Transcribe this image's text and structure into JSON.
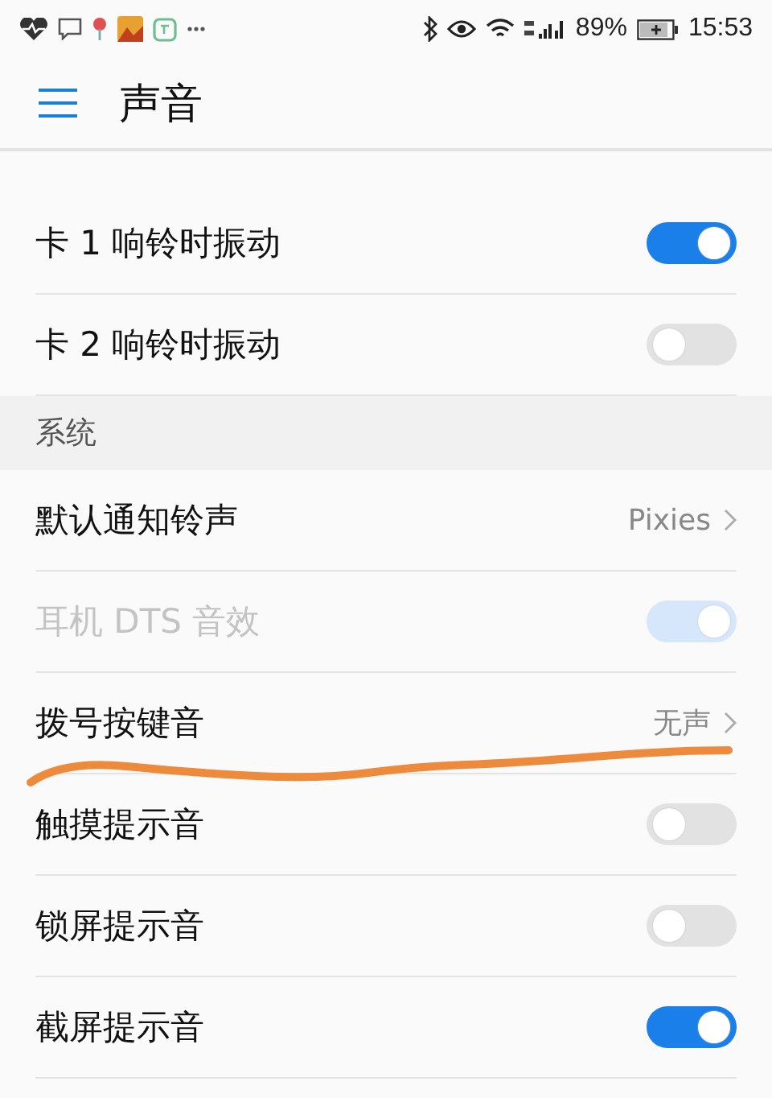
{
  "status_bar": {
    "battery": "89%",
    "time": "15:53"
  },
  "header": {
    "title": "声音"
  },
  "sections": [
    {
      "rows": [
        {
          "kind": "toggle",
          "label": "卡 1 响铃时振动",
          "on": true,
          "disabled": false
        },
        {
          "kind": "toggle",
          "label": "卡 2 响铃时振动",
          "on": false,
          "disabled": false
        }
      ]
    },
    {
      "title": "系统",
      "rows": [
        {
          "kind": "link",
          "label": "默认通知铃声",
          "value": "Pixies",
          "disabled": false
        },
        {
          "kind": "toggle",
          "label": "耳机 DTS 音效",
          "on": true,
          "disabled": true
        },
        {
          "kind": "link",
          "label": "拨号按键音",
          "value": "无声",
          "disabled": false
        },
        {
          "kind": "toggle",
          "label": "触摸提示音",
          "on": false,
          "disabled": false
        },
        {
          "kind": "toggle",
          "label": "锁屏提示音",
          "on": false,
          "disabled": false
        },
        {
          "kind": "toggle",
          "label": "截屏提示音",
          "on": true,
          "disabled": false
        }
      ]
    }
  ]
}
